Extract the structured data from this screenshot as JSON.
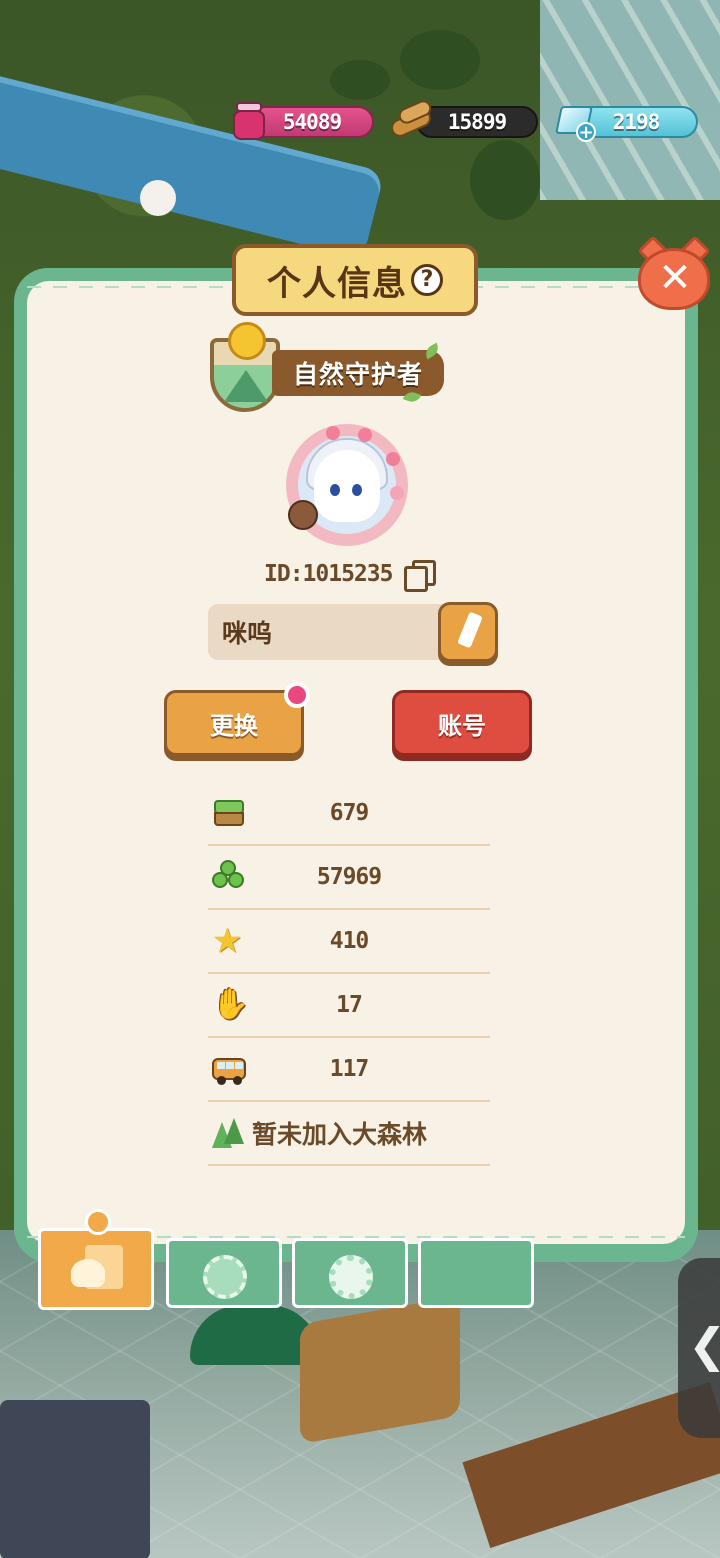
{
  "currencies": {
    "jam": {
      "icon": "jam-jar-icon",
      "value": "54089"
    },
    "wood": {
      "icon": "wood-log-icon",
      "value": "15899"
    },
    "gem": {
      "icon": "diamond-plus-icon",
      "value": "2198"
    }
  },
  "panel": {
    "title": "个人信息",
    "help_icon": "?",
    "close_icon": "✕"
  },
  "profile": {
    "badge_title": "自然守护者",
    "player_id": "ID:1015235",
    "nickname": "咪呜",
    "change_button": "更换",
    "account_button": "账号"
  },
  "stats": [
    {
      "icon": "grass-block-icon",
      "value": "679"
    },
    {
      "icon": "clover-icon",
      "value": "57969"
    },
    {
      "icon": "star-icon",
      "value": "410"
    },
    {
      "icon": "thumbs-up-icon",
      "value": "17"
    },
    {
      "icon": "bus-icon",
      "value": "117"
    }
  ],
  "forest_status": "暂未加入大森林",
  "tabs": [
    {
      "name": "profile-tab",
      "icon": "profile-card-icon",
      "active": true
    },
    {
      "name": "badges-tab",
      "icon": "badge-icon",
      "active": false
    },
    {
      "name": "settings-tab",
      "icon": "gear-icon",
      "active": false
    },
    {
      "name": "album-tab",
      "icon": "album-icon",
      "active": false
    }
  ],
  "side_arrow": "❮",
  "colors": {
    "panel_border": "#6cb68f",
    "panel_bg": "#f7f2e5",
    "title_plate": "#f6d97f",
    "change_button": "#e9a244",
    "account_button": "#df4d41",
    "close_button": "#ef6f4a"
  }
}
